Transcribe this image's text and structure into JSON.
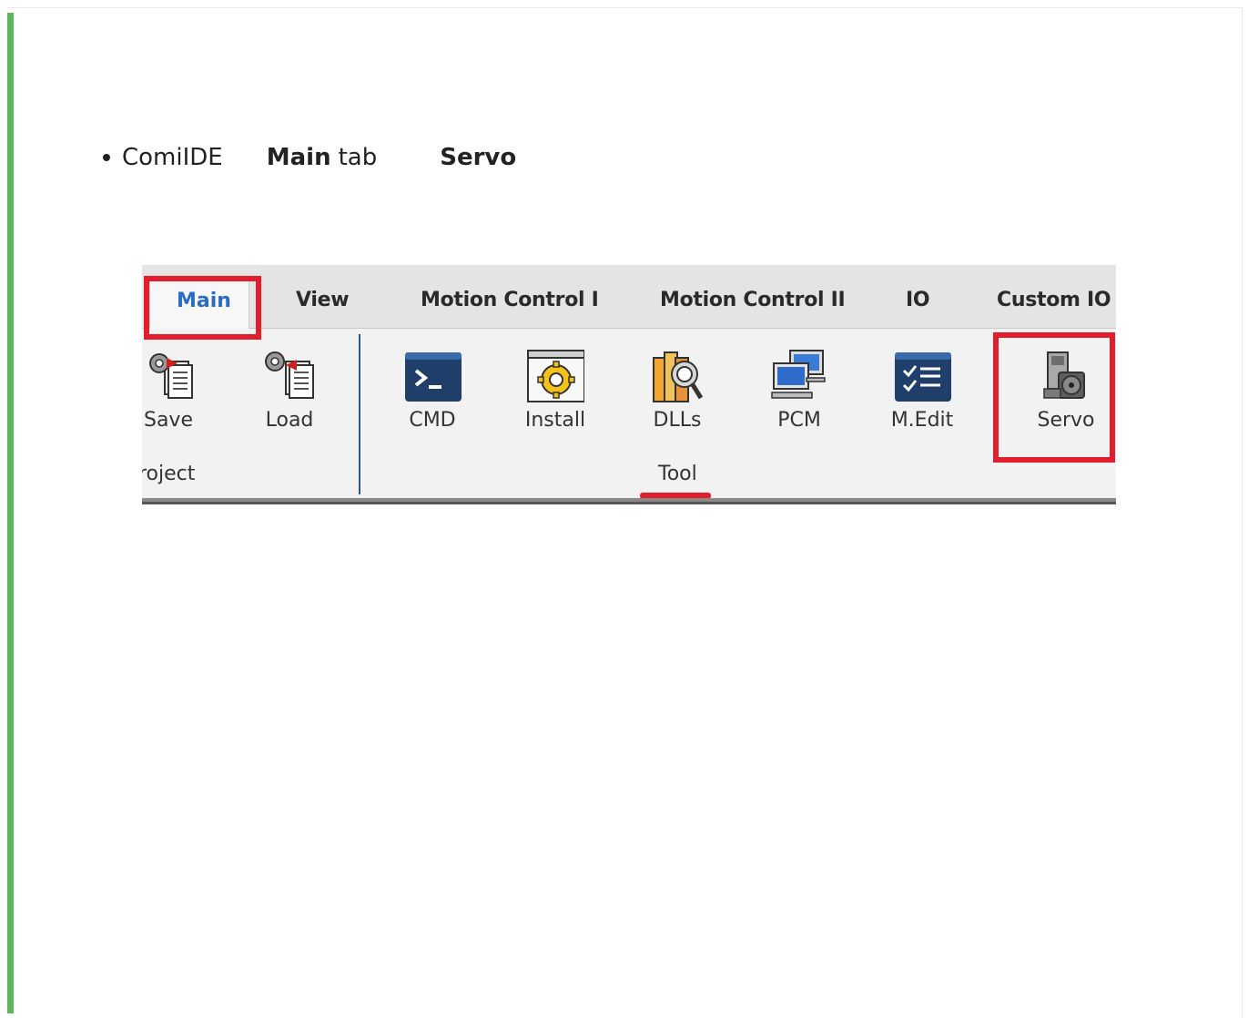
{
  "instruction": {
    "app": "ComiIDE",
    "tab_name": "Main",
    "tab_word": "tab",
    "target": "Servo"
  },
  "ribbon": {
    "tabs": [
      "Main",
      "View",
      "Motion Control I",
      "Motion Control II",
      "IO",
      "Custom IO"
    ],
    "project_group": {
      "label": "roject",
      "items": [
        "Save",
        "Load"
      ]
    },
    "tool_group": {
      "label": "Tool",
      "items": [
        "CMD",
        "Install",
        "DLLs",
        "PCM",
        "M.Edit",
        "Servo"
      ]
    }
  },
  "colors": {
    "highlight": "#e21d2c",
    "active_tab_text": "#2b6cc4",
    "accent_bar": "#5cb85c"
  }
}
